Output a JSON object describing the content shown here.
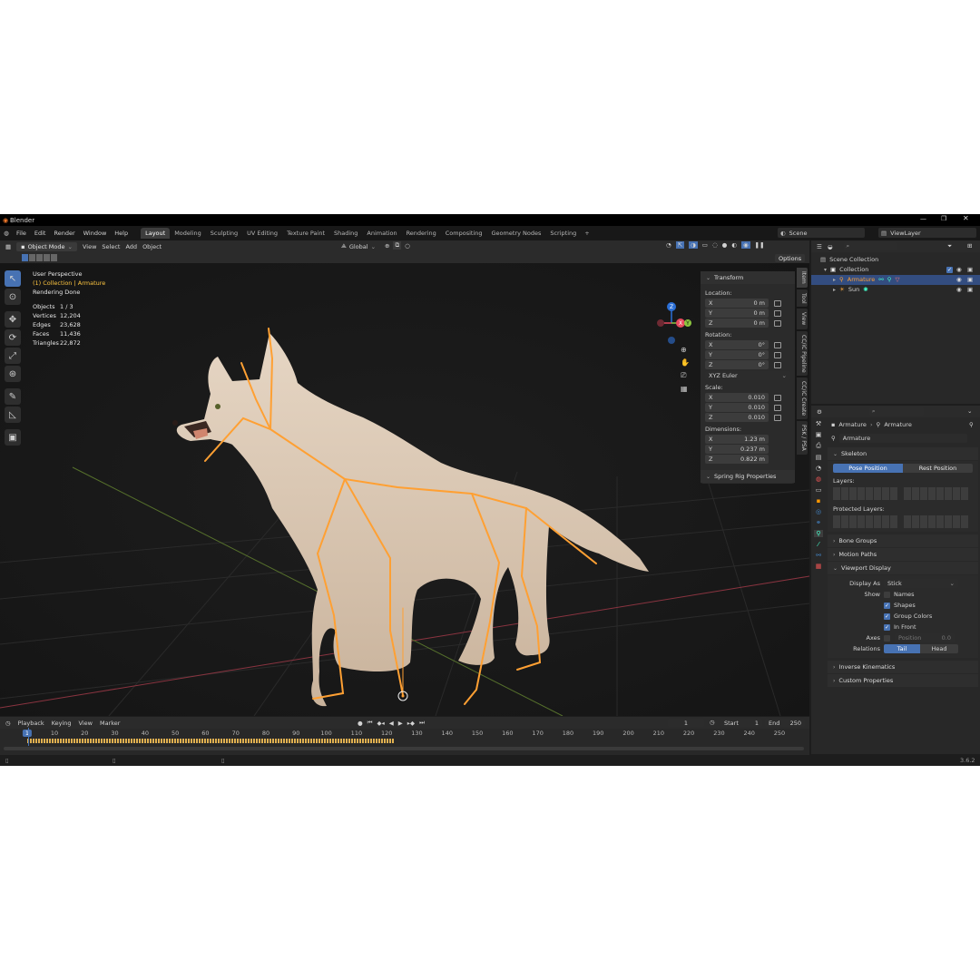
{
  "app": {
    "title": "Blender",
    "version": "3.6.2"
  },
  "menu": [
    "File",
    "Edit",
    "Render",
    "Window",
    "Help"
  ],
  "workspaces": [
    "Layout",
    "Modeling",
    "Sculpting",
    "UV Editing",
    "Texture Paint",
    "Shading",
    "Animation",
    "Rendering",
    "Compositing",
    "Geometry Nodes",
    "Scripting"
  ],
  "active_workspace": 0,
  "scene": {
    "name": "Scene",
    "view_layer": "ViewLayer"
  },
  "header": {
    "mode": "Object Mode",
    "view": "View",
    "select": "Select",
    "add": "Add",
    "object": "Object",
    "orientation": "Global",
    "options": "Options"
  },
  "viewport": {
    "title": "User Perspective",
    "collection_line": "(1) Collection | Armature",
    "status": "Rendering Done",
    "stats": [
      {
        "label": "Objects",
        "value": "1 / 3"
      },
      {
        "label": "Vertices",
        "value": "12,204"
      },
      {
        "label": "Edges",
        "value": "23,628"
      },
      {
        "label": "Faces",
        "value": "11,436"
      },
      {
        "label": "Triangles",
        "value": "22,872"
      }
    ],
    "gizmo": {
      "x": "X",
      "y": "Y",
      "z": "Z"
    }
  },
  "npanel": {
    "header": "Transform",
    "location_label": "Location:",
    "rotation_label": "Rotation:",
    "scale_label": "Scale:",
    "dimensions_label": "Dimensions:",
    "location": [
      {
        "axis": "X",
        "value": "0 m"
      },
      {
        "axis": "Y",
        "value": "0 m"
      },
      {
        "axis": "Z",
        "value": "0 m"
      }
    ],
    "rotation": [
      {
        "axis": "X",
        "value": "0°"
      },
      {
        "axis": "Y",
        "value": "0°"
      },
      {
        "axis": "Z",
        "value": "0°"
      }
    ],
    "rotation_mode": "XYZ Euler",
    "scale": [
      {
        "axis": "X",
        "value": "0.010"
      },
      {
        "axis": "Y",
        "value": "0.010"
      },
      {
        "axis": "Z",
        "value": "0.010"
      }
    ],
    "dimensions": [
      {
        "axis": "X",
        "value": "1.23 m"
      },
      {
        "axis": "Y",
        "value": "0.237 m"
      },
      {
        "axis": "Z",
        "value": "0.822 m"
      }
    ],
    "spring": "Spring Rig Properties",
    "tabs": [
      "Item",
      "Tool",
      "View",
      "CC/iC Pipeline",
      "CC/iC Create",
      "PSK / PSA"
    ]
  },
  "outliner": {
    "root": "Scene Collection",
    "collection": "Collection",
    "items": [
      "Armature",
      "Sun"
    ]
  },
  "properties": {
    "breadcrumb_a": "Armature",
    "breadcrumb_b": "Armature",
    "data_name": "Armature",
    "skeleton": "Skeleton",
    "pose_position": "Pose Position",
    "rest_position": "Rest Position",
    "layers": "Layers:",
    "protected_layers": "Protected Layers:",
    "bone_groups": "Bone Groups",
    "motion_paths": "Motion Paths",
    "viewport_display": "Viewport Display",
    "display_as_label": "Display As",
    "display_as": "Stick",
    "show_label": "Show",
    "show_items": [
      {
        "label": "Names",
        "checked": false
      },
      {
        "label": "Shapes",
        "checked": true
      },
      {
        "label": "Group Colors",
        "checked": true
      },
      {
        "label": "In Front",
        "checked": true
      }
    ],
    "axes_label": "Axes",
    "axes_position": "Position",
    "axes_value": "0.0",
    "relations_label": "Relations",
    "relations_tail": "Tail",
    "relations_head": "Head",
    "inverse_kinematics": "Inverse Kinematics",
    "custom_properties": "Custom Properties"
  },
  "timeline": {
    "playback": "Playback",
    "keying": "Keying",
    "view": "View",
    "marker": "Marker",
    "current_frame": "1",
    "start_label": "Start",
    "start": "1",
    "end_label": "End",
    "end": "250",
    "ticks": [
      "1",
      "10",
      "20",
      "30",
      "40",
      "50",
      "60",
      "70",
      "80",
      "90",
      "100",
      "110",
      "120",
      "130",
      "140",
      "150",
      "160",
      "170",
      "180",
      "190",
      "200",
      "210",
      "220",
      "230",
      "240",
      "250"
    ]
  },
  "colors": {
    "accent": "#4772b3",
    "bone": "#ffa033",
    "active_text": "#ffc640",
    "bg": "#1d1d1d"
  }
}
